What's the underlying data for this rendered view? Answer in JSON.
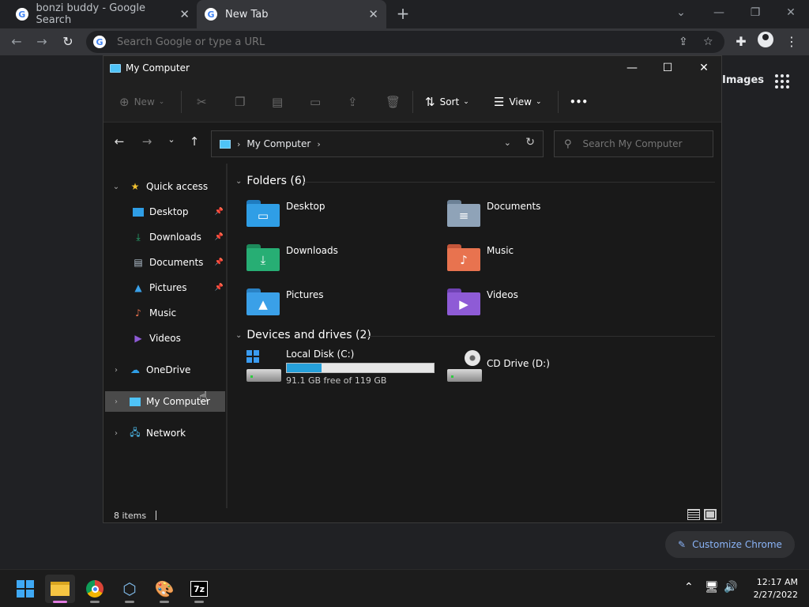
{
  "chrome": {
    "tabs": [
      {
        "title": "bonzi buddy - Google Search",
        "favicon": "G",
        "active": false
      },
      {
        "title": "New Tab",
        "favicon": "G",
        "active": true
      }
    ],
    "omnibox_placeholder": "Search Google or type a URL",
    "ntp_images_link": "Images",
    "customize_label": "Customize Chrome"
  },
  "explorer": {
    "title": "My Computer",
    "commands": {
      "new": "New",
      "sort": "Sort",
      "view": "View",
      "more": "•••"
    },
    "address": {
      "crumb": "My Computer"
    },
    "search_placeholder": "Search My Computer",
    "sidebar": {
      "quick_access": "Quick access",
      "items": [
        {
          "label": "Desktop",
          "pinned": true
        },
        {
          "label": "Downloads",
          "pinned": true
        },
        {
          "label": "Documents",
          "pinned": true
        },
        {
          "label": "Pictures",
          "pinned": true
        },
        {
          "label": "Music",
          "pinned": false
        },
        {
          "label": "Videos",
          "pinned": false
        }
      ],
      "onedrive": "OneDrive",
      "my_computer": "My Computer",
      "network": "Network"
    },
    "folders_header": "Folders (6)",
    "folders": [
      {
        "label": "Desktop",
        "color": "#2f9ee6"
      },
      {
        "label": "Documents",
        "color": "#8fa3b8"
      },
      {
        "label": "Downloads",
        "color": "#27ae74"
      },
      {
        "label": "Music",
        "color": "#e8734f"
      },
      {
        "label": "Pictures",
        "color": "#3aa0e8"
      },
      {
        "label": "Videos",
        "color": "#8e5bd6"
      }
    ],
    "drives_header": "Devices and drives (2)",
    "drives": [
      {
        "label": "Local Disk (C:)",
        "free_text": "91.1 GB free of 119 GB",
        "used_fraction": 0.234
      },
      {
        "label": "CD Drive (D:)"
      }
    ],
    "status_count": "8 items"
  },
  "taskbar": {
    "time": "12:17 AM",
    "date": "2/27/2022",
    "sevenzip_label": "7z"
  }
}
